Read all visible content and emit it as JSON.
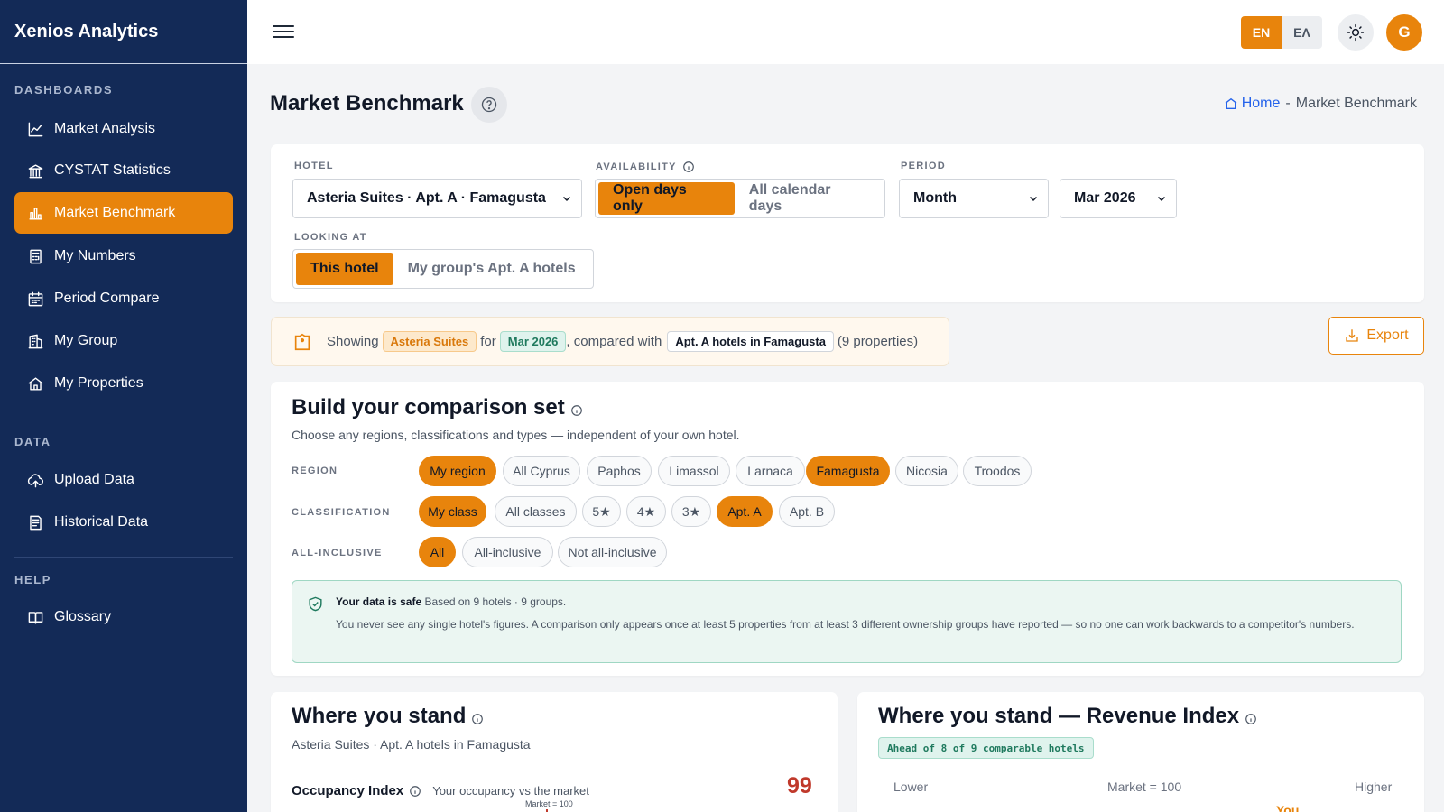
{
  "app": {
    "brand": "Xenios Analytics"
  },
  "sidebar": {
    "sections": [
      {
        "label": "DASHBOARDS"
      },
      {
        "label": "DATA"
      },
      {
        "label": "HELP"
      }
    ],
    "items": [
      {
        "label": "Market Analysis",
        "icon": "line-chart-icon"
      },
      {
        "label": "CYSTAT Statistics",
        "icon": "bank-icon"
      },
      {
        "label": "Market Benchmark",
        "icon": "bar-chart-icon",
        "active": true
      },
      {
        "label": "My Numbers",
        "icon": "calculator-icon"
      },
      {
        "label": "Period Compare",
        "icon": "calendar-icon"
      },
      {
        "label": "My Group",
        "icon": "building-icon"
      },
      {
        "label": "My Properties",
        "icon": "home-icon"
      },
      {
        "label": "Upload Data",
        "icon": "upload-cloud-icon"
      },
      {
        "label": "Historical Data",
        "icon": "document-list-icon"
      },
      {
        "label": "Glossary",
        "icon": "book-icon"
      }
    ]
  },
  "topbar": {
    "lang_en": "EN",
    "lang_el": "ΕΛ",
    "avatar_initial": "G"
  },
  "page": {
    "title": "Market Benchmark",
    "breadcrumb": {
      "home": "Home",
      "separator": "-",
      "current": "Market Benchmark"
    }
  },
  "filters": {
    "hotel_label": "HOTEL",
    "hotel_value": "Asteria Suites · Apt. A · Famagusta",
    "availability_label": "AVAILABILITY",
    "availability_options": [
      "Open days only",
      "All calendar days"
    ],
    "period_label": "PERIOD",
    "period_value": "Month",
    "month_value": "Mar 2026",
    "looking_at_label": "LOOKING AT",
    "looking_at_options": [
      "This hotel",
      "My group's Apt. A hotels"
    ]
  },
  "showing": {
    "prefix": "Showing",
    "hotel": "Asteria Suites",
    "for": "for",
    "period": "Mar 2026",
    "compared": ", compared with",
    "set": "Apt. A hotels in Famagusta",
    "count": "(9 properties)"
  },
  "export_label": "Export",
  "comparison": {
    "title": "Build your comparison set",
    "subtitle": "Choose any regions, classifications and types — independent of your own hotel.",
    "region_label": "REGION",
    "regions": [
      {
        "label": "My region",
        "on": true
      },
      {
        "label": "All Cyprus",
        "on": false
      },
      {
        "label": "Paphos",
        "on": false
      },
      {
        "label": "Limassol",
        "on": false
      },
      {
        "label": "Larnaca",
        "on": false
      },
      {
        "label": "Famagusta",
        "on": true
      },
      {
        "label": "Nicosia",
        "on": false
      },
      {
        "label": "Troodos",
        "on": false
      }
    ],
    "class_label": "CLASSIFICATION",
    "classes": [
      {
        "label": "My class",
        "on": true
      },
      {
        "label": "All classes",
        "on": false
      },
      {
        "label": "5★",
        "on": false
      },
      {
        "label": "4★",
        "on": false
      },
      {
        "label": "3★",
        "on": false
      },
      {
        "label": "Apt. A",
        "on": true
      },
      {
        "label": "Apt. B",
        "on": false
      }
    ],
    "ai_label": "ALL-INCLUSIVE",
    "all_inclusive": [
      {
        "label": "All",
        "on": true
      },
      {
        "label": "All-inclusive",
        "on": false
      },
      {
        "label": "Not all-inclusive",
        "on": false
      }
    ],
    "safe_title": "Your data is safe",
    "safe_meta": "Based on 9 hotels · 9 groups.",
    "safe_body": "You never see any single hotel's figures. A comparison only appears once at least 5 properties from at least 3 different ownership groups have reported — so no one can work backwards to a competitor's numbers."
  },
  "stand": {
    "title": "Where you stand",
    "subtitle": "Asteria Suites · Apt. A hotels in Famagusta",
    "occ_label": "Occupancy Index",
    "occ_desc": "Your occupancy vs the market",
    "occ_value": "99",
    "market_marker": "Market = 100"
  },
  "revenue": {
    "title": "Where you stand — Revenue Index",
    "badge": "Ahead of 8 of 9 comparable hotels",
    "lower": "Lower",
    "market": "Market = 100",
    "higher": "Higher",
    "you": "You"
  },
  "colors": {
    "accent": "#e8840c",
    "sidebar": "#132a57",
    "safe": "#ebf6f2",
    "index_red": "#c0392b"
  }
}
